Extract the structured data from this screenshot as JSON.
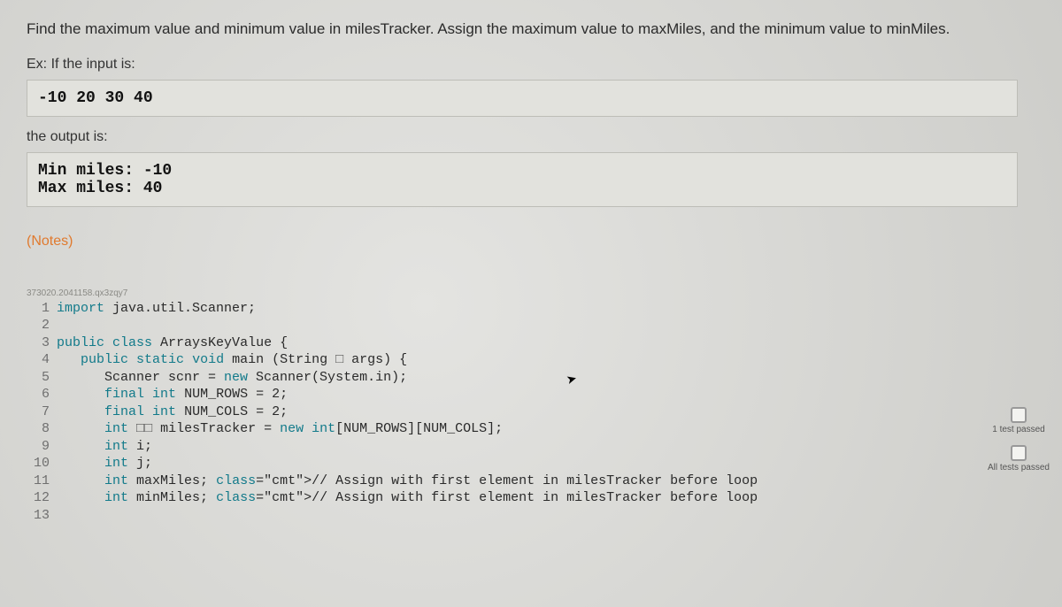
{
  "prompt": "Find the maximum value and minimum value in milesTracker. Assign the maximum value to maxMiles, and the minimum value to minMiles.",
  "example": {
    "input_label": "Ex: If the input is:",
    "input_value": "-10 20 30 40",
    "output_label": "the output is:",
    "output_value": "Min miles: -10\nMax miles: 40"
  },
  "notes_label": "(Notes)",
  "challenge_id": "373020.2041158.qx3zqy7",
  "code_lines": [
    "import java.util.Scanner;",
    "",
    "public class ArraysKeyValue {",
    "   public static void main (String □ args) {",
    "      Scanner scnr = new Scanner(System.in);",
    "      final int NUM_ROWS = 2;",
    "      final int NUM_COLS = 2;",
    "      int □□ milesTracker = new int[NUM_ROWS][NUM_COLS];",
    "      int i;",
    "      int j;",
    "      int maxMiles; // Assign with first element in milesTracker before loop",
    "      int minMiles; // Assign with first element in milesTracker before loop",
    ""
  ],
  "gutter_start": 1,
  "gutter_end": 13,
  "badges": {
    "one_test": "1 test\npassed",
    "all_tests": "All tests\npassed"
  }
}
